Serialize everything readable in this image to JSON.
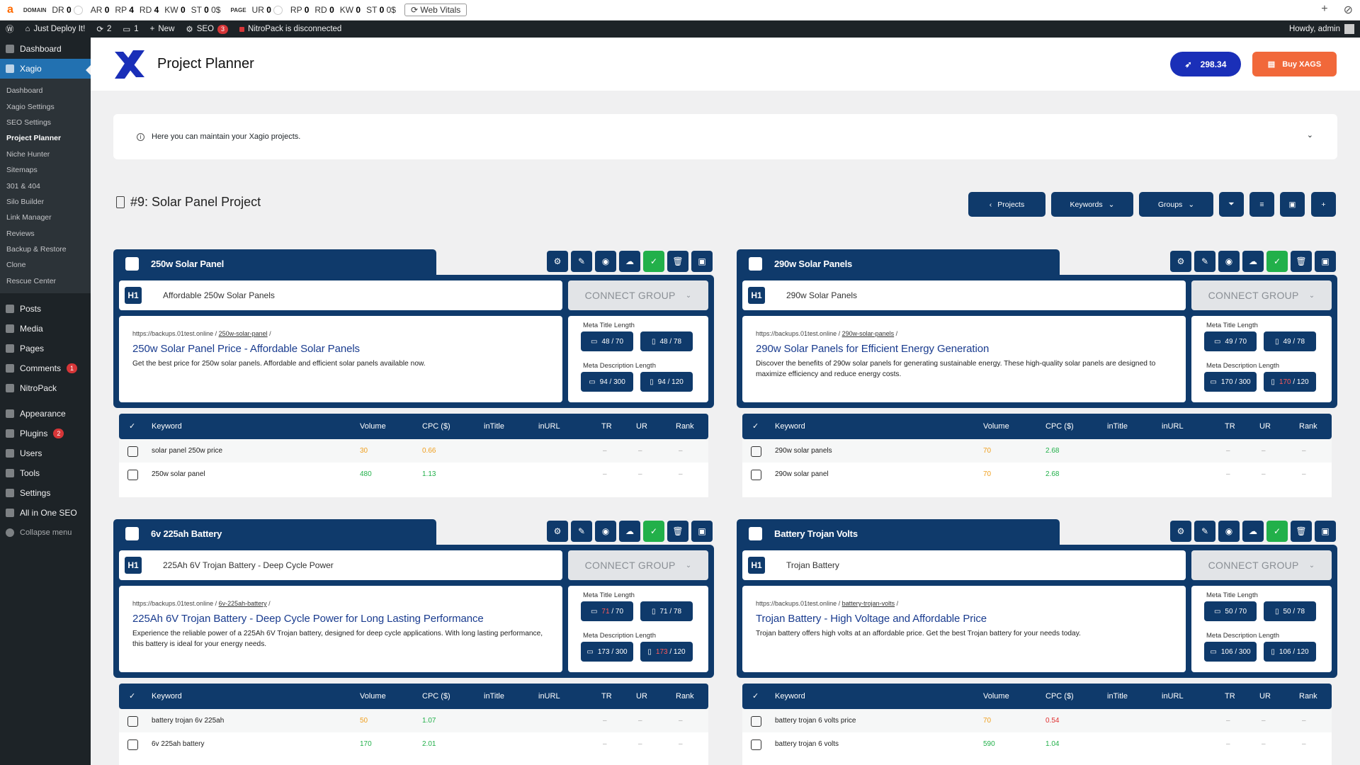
{
  "ext": {
    "logo": "a",
    "domain_label": "DOMAIN",
    "page_label": "PAGE",
    "domain_metrics": [
      {
        "k": "DR",
        "v": "0"
      },
      {
        "k": "AR",
        "v": "0"
      },
      {
        "k": "RP",
        "v": "4"
      },
      {
        "k": "RD",
        "v": "4"
      },
      {
        "k": "KW",
        "v": "0"
      },
      {
        "k": "ST",
        "v": "0"
      }
    ],
    "domain_money": "0$",
    "page_metrics": [
      {
        "k": "UR",
        "v": "0"
      },
      {
        "k": "RP",
        "v": "0"
      },
      {
        "k": "RD",
        "v": "0"
      },
      {
        "k": "KW",
        "v": "0"
      },
      {
        "k": "ST",
        "v": "0"
      }
    ],
    "page_money": "0$",
    "web_vitals": "Web Vitals"
  },
  "adminbar": {
    "site": "Just Deploy It!",
    "updates": "2",
    "comments": "1",
    "new": "New",
    "seo": "SEO",
    "seo_badge": "3",
    "nitro": "NitroPack is disconnected",
    "howdy": "Howdy, admin"
  },
  "sidebar": {
    "dashboard": "Dashboard",
    "xagio": "Xagio",
    "sub": [
      "Dashboard",
      "Xagio Settings",
      "SEO Settings",
      "Project Planner",
      "Niche Hunter",
      "Sitemaps",
      "301 & 404",
      "Silo Builder",
      "Link Manager",
      "Reviews",
      "Backup & Restore",
      "Clone",
      "Rescue Center"
    ],
    "menu": [
      {
        "label": "Posts",
        "badge": null
      },
      {
        "label": "Media",
        "badge": null
      },
      {
        "label": "Pages",
        "badge": null
      },
      {
        "label": "Comments",
        "badge": "1"
      },
      {
        "label": "NitroPack",
        "badge": null
      }
    ],
    "menu2": [
      {
        "label": "Appearance",
        "badge": null
      },
      {
        "label": "Plugins",
        "badge": "2"
      },
      {
        "label": "Users",
        "badge": null
      },
      {
        "label": "Tools",
        "badge": null
      },
      {
        "label": "Settings",
        "badge": null
      },
      {
        "label": "All in One SEO",
        "badge": null
      }
    ],
    "collapse": "Collapse menu"
  },
  "header": {
    "title": "Project Planner",
    "credits": "298.34",
    "buy": "Buy XAGS",
    "brand_color": "#1a2fb8",
    "buy_color": "#f1683a"
  },
  "info": {
    "text": "Here you can maintain your Xagio projects."
  },
  "project": {
    "title": "#9: Solar Panel Project"
  },
  "toolbar": {
    "projects": "Projects",
    "keywords": "Keywords",
    "groups": "Groups"
  },
  "connect_label": "CONNECT GROUP",
  "meta_title_label": "Meta Title Length",
  "meta_desc_label": "Meta Description Length",
  "kw_headers": {
    "keyword": "Keyword",
    "volume": "Volume",
    "cpc": "CPC ($)",
    "intitle": "inTitle",
    "inurl": "inURL",
    "tr": "TR",
    "ur": "UR",
    "rank": "Rank"
  },
  "groups": [
    {
      "name": "250w Solar Panel",
      "h1": "Affordable 250w Solar Panels",
      "domain": "https://backups.01test.online /",
      "slug": "250w-solar-panel",
      "title": "250w Solar Panel Price - Affordable Solar Panels",
      "desc": "Get the best price for 250w solar panels. Affordable and efficient solar panels available now.",
      "mt_d": "48 / 70",
      "mt_m": "48 / 78",
      "md_d": "94 / 300",
      "md_m": "94 / 120",
      "keywords": [
        {
          "kw": "solar panel 250w price",
          "vol": "30",
          "cpc": "0.66",
          "vc": "or",
          "cc": "or"
        },
        {
          "kw": "250w solar panel",
          "vol": "480",
          "cpc": "1.13",
          "vc": "gr",
          "cc": "gr"
        }
      ]
    },
    {
      "name": "290w Solar Panels",
      "h1": "290w Solar Panels",
      "domain": "https://backups.01test.online /",
      "slug": "290w-solar-panels",
      "title": "290w Solar Panels for Efficient Energy Generation",
      "desc": "Discover the benefits of 290w solar panels for generating sustainable energy. These high-quality solar panels are designed to maximize efficiency and reduce energy costs.",
      "mt_d": "49 / 70",
      "mt_m": "49 / 78",
      "md_d": "170 / 300",
      "md_m_red": "170",
      "md_m_rest": " / 120",
      "keywords": [
        {
          "kw": "290w solar panels",
          "vol": "70",
          "cpc": "2.68",
          "vc": "or",
          "cc": "gr"
        },
        {
          "kw": "290w solar panel",
          "vol": "70",
          "cpc": "2.68",
          "vc": "or",
          "cc": "gr"
        }
      ]
    },
    {
      "name": "6v 225ah Battery",
      "h1": "225Ah 6V Trojan Battery - Deep Cycle Power",
      "domain": "https://backups.01test.online /",
      "slug": "6v-225ah-battery",
      "title": "225Ah 6V Trojan Battery - Deep Cycle Power for Long Lasting Performance",
      "desc": "Experience the reliable power of a 225Ah 6V Trojan battery, designed for deep cycle applications. With long lasting performance, this battery is ideal for your energy needs.",
      "mt_d_red": "71",
      "mt_d_rest": " / 70",
      "mt_m": "71 / 78",
      "md_d": "173 / 300",
      "md_m_red": "173",
      "md_m_rest": " / 120",
      "keywords": [
        {
          "kw": "battery trojan 6v 225ah",
          "vol": "50",
          "cpc": "1.07",
          "vc": "or",
          "cc": "gr"
        },
        {
          "kw": "6v 225ah battery",
          "vol": "170",
          "cpc": "2.01",
          "vc": "gr",
          "cc": "gr"
        }
      ]
    },
    {
      "name": "Battery Trojan Volts",
      "h1": "Trojan Battery",
      "domain": "https://backups.01test.online /",
      "slug": "battery-trojan-volts",
      "title": "Trojan Battery - High Voltage and Affordable Price",
      "desc": "Trojan battery offers high volts at an affordable price. Get the best Trojan battery for your needs today.",
      "mt_d": "50 / 70",
      "mt_m": "50 / 78",
      "md_d": "106 / 300",
      "md_m": "106 / 120",
      "keywords": [
        {
          "kw": "battery trojan 6 volts price",
          "vol": "70",
          "cpc": "0.54",
          "vc": "or",
          "cc": "rd"
        },
        {
          "kw": "battery trojan 6 volts",
          "vol": "590",
          "cpc": "1.04",
          "vc": "gr",
          "cc": "gr"
        }
      ]
    }
  ]
}
